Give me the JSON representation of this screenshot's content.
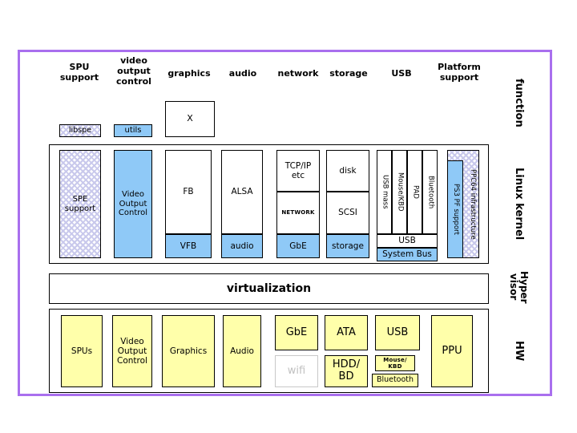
{
  "diagram": {
    "title_columns": [
      {
        "label": "SPU\nsupport"
      },
      {
        "label": "video\noutput\ncontrol"
      },
      {
        "label": "graphics"
      },
      {
        "label": "audio"
      },
      {
        "label": "network"
      },
      {
        "label": "storage"
      },
      {
        "label": "USB"
      },
      {
        "label": "Platform\nsupport"
      }
    ],
    "band_labels": {
      "function": "function",
      "kernel": "Linux kernel",
      "hypervisor": "Hyper\nvisor",
      "hardware": "HW"
    },
    "userspace": {
      "libspe": "libspe",
      "utils": "utils",
      "x": "X"
    },
    "kernel": {
      "spe_support": "SPE\nsupport",
      "video_output_control": "Video\nOutput\nControl",
      "fb": "FB",
      "vfb": "VFB",
      "alsa": "ALSA",
      "audio": "audio",
      "tcpip": "TCP/IP\netc",
      "network": "NETWORK",
      "gbe": "GbE",
      "disk": "disk",
      "scsi": "SCSI",
      "storage": "storage",
      "usb_mass": "USB mass",
      "mouse_kbd": "Mouse/KBD",
      "pad": "PAD",
      "bluetooth": "Bluetooth",
      "usb": "USB",
      "system_bus": "System Bus",
      "ppc64_infrastructure": "PPC64 infrastructure",
      "ps3_pf_support": "PS3 PF support"
    },
    "virtualization": {
      "label": "virtualization"
    },
    "hardware": {
      "spus": "SPUs",
      "video_output_control": "Video\nOutput\nControl",
      "graphics": "Graphics",
      "audio": "Audio",
      "gbe": "GbE",
      "wifi": "wifi",
      "ata": "ATA",
      "hdd_bd": "HDD/\nBD",
      "usb": "USB",
      "mouse_kbd": "Mouse/\nKBD",
      "bluetooth": "Bluetooth",
      "ppu": "PPU"
    },
    "colors": {
      "frame_border": "#a96fee",
      "blue_fill": "#8fc9f7",
      "yellow_fill": "#ffffaa",
      "hatch_line": "#c9c9ec",
      "disabled_text": "#c0c0c0"
    }
  }
}
